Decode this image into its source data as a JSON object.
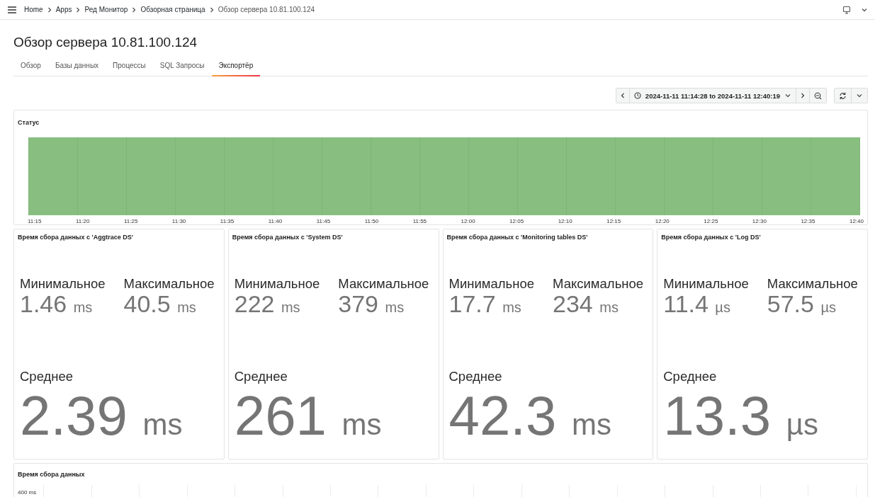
{
  "breadcrumbs": [
    {
      "label": "Home",
      "current": false
    },
    {
      "label": "Apps",
      "current": false
    },
    {
      "label": "Ред Монитор",
      "current": false
    },
    {
      "label": "Обзорная страница",
      "current": false
    },
    {
      "label": "Обзор сервера 10.81.100.124",
      "current": true
    }
  ],
  "title": "Обзор сервера 10.81.100.124",
  "tabs": [
    {
      "label": "Обзор",
      "selected": false
    },
    {
      "label": "Базы данных",
      "selected": false
    },
    {
      "label": "Процессы",
      "selected": false
    },
    {
      "label": "SQL Запросы",
      "selected": false
    },
    {
      "label": "Экспортёр",
      "selected": true
    }
  ],
  "time_range": {
    "label": "2024-11-11 11:14:28 to 2024-11-11 12:40:19"
  },
  "status_panel": {
    "title": "Статус",
    "ticks": [
      "11:15",
      "11:20",
      "11:25",
      "11:30",
      "11:35",
      "11:40",
      "11:45",
      "11:50",
      "11:55",
      "12:00",
      "12:05",
      "12:10",
      "12:15",
      "12:20",
      "12:25",
      "12:30",
      "12:35",
      "12:40"
    ]
  },
  "stat_panels": [
    {
      "title": "Время сбора данных с 'Aggtrace DS'",
      "min_label": "Минимальное",
      "min_value": "1.46",
      "min_unit": "ms",
      "max_label": "Максимальное",
      "max_value": "40.5",
      "max_unit": "ms",
      "avg_label": "Среднее",
      "avg_value": "2.39",
      "avg_unit": "ms"
    },
    {
      "title": "Время сбора данных с 'System DS'",
      "min_label": "Минимальное",
      "min_value": "222",
      "min_unit": "ms",
      "max_label": "Максимальное",
      "max_value": "379",
      "max_unit": "ms",
      "avg_label": "Среднее",
      "avg_value": "261",
      "avg_unit": "ms"
    },
    {
      "title": "Время сбора данных с 'Monitoring tables DS'",
      "min_label": "Минимальное",
      "min_value": "17.7",
      "min_unit": "ms",
      "max_label": "Максимальное",
      "max_value": "234",
      "max_unit": "ms",
      "avg_label": "Среднее",
      "avg_value": "42.3",
      "avg_unit": "ms"
    },
    {
      "title": "Время сбора данных с 'Log DS'",
      "min_label": "Минимальное",
      "min_value": "11.4",
      "min_unit": "µs",
      "max_label": "Максимальное",
      "max_value": "57.5",
      "max_unit": "µs",
      "avg_label": "Среднее",
      "avg_value": "13.3",
      "avg_unit": "µs"
    }
  ],
  "bottom_panel": {
    "title": "Время сбора данных",
    "y_label": "400 ms"
  }
}
